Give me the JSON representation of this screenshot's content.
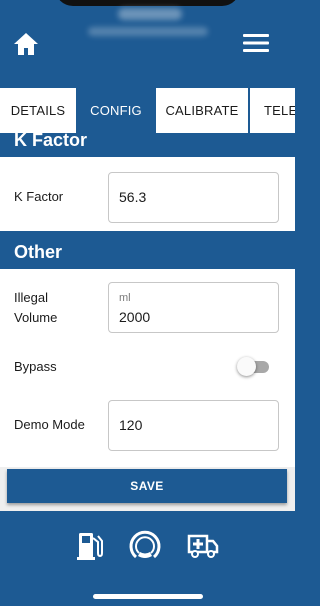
{
  "tabs": [
    {
      "label": "DETAILS",
      "active": false
    },
    {
      "label": "CONFIG",
      "active": true
    },
    {
      "label": "CALIBRATE",
      "active": false
    },
    {
      "label": "TELE",
      "active": false
    }
  ],
  "sections": {
    "k_factor": {
      "header": "K Factor",
      "label": "K Factor",
      "value": "56.3"
    },
    "other": {
      "header": "Other",
      "illegal_volume": {
        "label": "Illegal Volume",
        "unit": "ml",
        "value": "2000"
      },
      "bypass": {
        "label": "Bypass",
        "enabled": false
      },
      "demo_mode": {
        "label": "Demo Mode",
        "value": "120"
      }
    }
  },
  "save_label": "SAVE",
  "icons": {
    "home": "home-icon",
    "menu": "hamburger-menu-icon",
    "fuel": "fuel-pump-icon",
    "gauge": "gauge-icon",
    "ambulance": "ambulance-icon"
  },
  "colors": {
    "primary": "#1d5a93",
    "surface": "#ffffff",
    "save_strip": "#efefef"
  }
}
